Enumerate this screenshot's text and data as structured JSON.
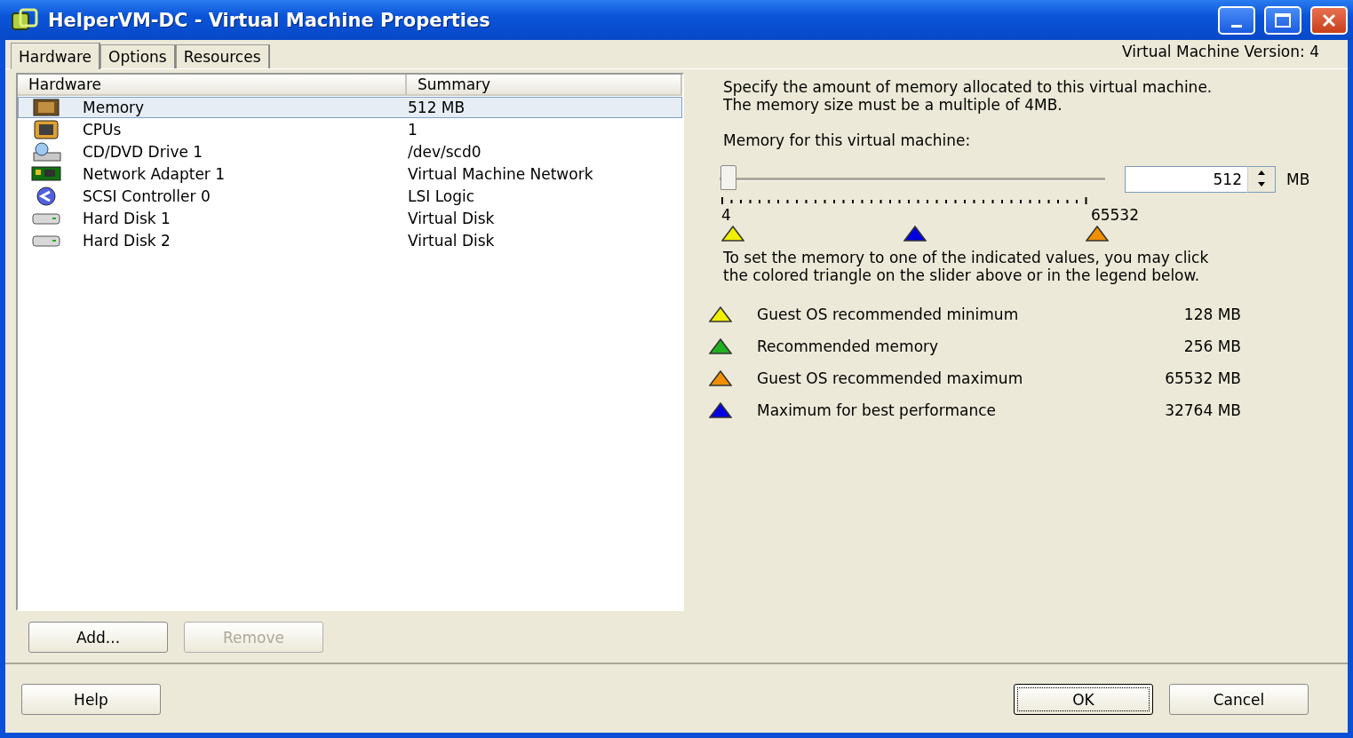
{
  "window": {
    "title": "HelperVM-DC - Virtual Machine Properties"
  },
  "tabs": [
    {
      "label": "Hardware",
      "selected": true
    },
    {
      "label": "Options",
      "selected": false
    },
    {
      "label": "Resources",
      "selected": false
    }
  ],
  "version": "Virtual Machine Version: 4",
  "table": {
    "columns": [
      "Hardware",
      "Summary"
    ],
    "rows": [
      {
        "kind": "memory",
        "name": "Memory",
        "summary": "512 MB",
        "selected": true
      },
      {
        "kind": "cpu",
        "name": "CPUs",
        "summary": "1",
        "selected": false
      },
      {
        "kind": "cdrom",
        "name": "CD/DVD Drive 1",
        "summary": "/dev/scd0",
        "selected": false
      },
      {
        "kind": "network",
        "name": "Network Adapter 1",
        "summary": "Virtual Machine Network",
        "selected": false
      },
      {
        "kind": "scsi",
        "name": "SCSI Controller 0",
        "summary": "LSI Logic",
        "selected": false
      },
      {
        "kind": "disk",
        "name": "Hard Disk 1",
        "summary": "Virtual Disk",
        "selected": false
      },
      {
        "kind": "disk",
        "name": "Hard Disk 2",
        "summary": "Virtual Disk",
        "selected": false
      }
    ]
  },
  "list_buttons": [
    {
      "label": "Add...",
      "disabled": false
    },
    {
      "label": "Remove",
      "disabled": true
    }
  ],
  "memory": {
    "description": "Specify the amount of memory allocated to this virtual machine. The memory size must be a multiple of 4MB.",
    "slider_label": "Memory for this virtual machine:",
    "slider": {
      "level": 0.008,
      "min_label": "4",
      "max_label": "65532",
      "markers": [
        {
          "color": "#f0f000"
        },
        {
          "color": "#0000e0"
        },
        {
          "color": "#f09000"
        }
      ]
    },
    "value": "512",
    "unit": "MB",
    "hint": "To set the memory to one of the indicated values, you may click the colored triangle on the slider above or in the legend below.",
    "legend": [
      {
        "color": "#f0f000",
        "label": "Guest OS recommended minimum",
        "value": "128 MB"
      },
      {
        "color": "#20b020",
        "label": "Recommended memory",
        "value": "256 MB"
      },
      {
        "color": "#f09000",
        "label": "Guest OS recommended maximum",
        "value": "65532 MB"
      },
      {
        "color": "#0000e0",
        "label": "Maximum for best performance",
        "value": "32764 MB"
      }
    ]
  },
  "footer_buttons": [
    {
      "label": "Help",
      "focused": false
    },
    {
      "label": "OK",
      "focused": true
    },
    {
      "label": "Cancel",
      "focused": false
    }
  ]
}
